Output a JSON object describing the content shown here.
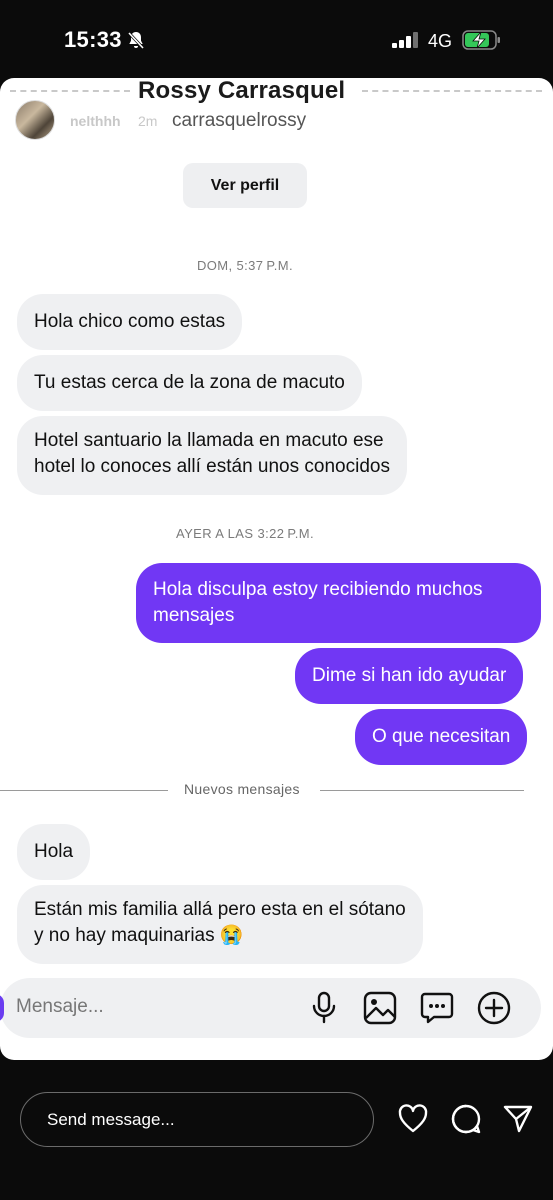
{
  "status_bar": {
    "time": "15:33",
    "network": "4G",
    "icons": [
      "bell-slash-icon",
      "signal-bars-icon",
      "battery-charging-icon"
    ]
  },
  "story": {
    "username": "nelthhh",
    "time_ago": "2m",
    "icons": [
      "more-icon",
      "close-icon"
    ]
  },
  "chat": {
    "name": "Rossy Carrasquel",
    "handle": "carrasquelrossy",
    "view_profile": "Ver perfil",
    "timestamp_1": "DOM, 5:37 P.M.",
    "timestamp_2": "AYER A LAS 3:22 P.M.",
    "new_messages": "Nuevos mensajes",
    "messages": [
      {
        "from": "them",
        "lines": [
          "Hola chico como estas"
        ]
      },
      {
        "from": "them",
        "lines": [
          "Tu estas cerca de la zona de macuto"
        ]
      },
      {
        "from": "them",
        "lines": [
          "Hotel santuario la llamada en macuto ese",
          "hotel lo conoces allí están unos conocidos"
        ]
      },
      {
        "from": "me",
        "lines": [
          "Hola disculpa estoy recibiendo muchos",
          "mensajes"
        ]
      },
      {
        "from": "me",
        "lines": [
          "Dime si han ido ayudar"
        ]
      },
      {
        "from": "me",
        "lines": [
          "O que necesitan"
        ]
      },
      {
        "from": "them",
        "lines": [
          "Hola"
        ]
      },
      {
        "from": "them",
        "lines": [
          "Están mis familia allá pero esta en el sótano",
          "y no hay maquinarias 😭"
        ]
      }
    ],
    "composer": {
      "placeholder": "Mensaje...",
      "icons": [
        "microphone-icon",
        "image-icon",
        "sticker-chat-icon",
        "add-icon"
      ]
    }
  },
  "reply_bar": {
    "placeholder": "Send message...",
    "icons": [
      "heart-icon",
      "reply-icon",
      "share-icon"
    ]
  },
  "colors": {
    "outgoing_bubble": "#7137f4",
    "incoming_bubble": "#eff0f2",
    "background": "#0b0b0b"
  }
}
